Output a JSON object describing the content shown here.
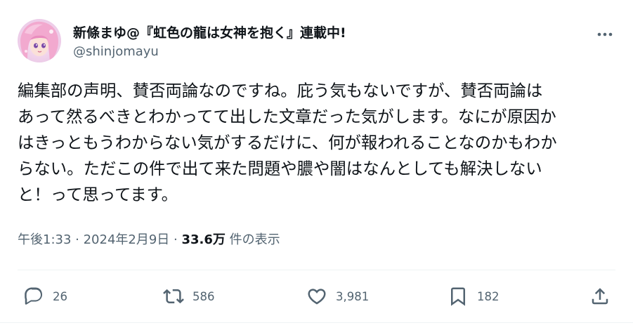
{
  "author": {
    "display_name": "新條まゆ@『虹色の龍は女神を抱く』連載中!",
    "handle": "@shinjomayu",
    "avatar_icon": "avatar-illustration"
  },
  "tweet": {
    "text": "編集部の声明、賛否両論なのですね。庇う気もないですが、賛否両論は\nあって然るべきとわかってて出した文章だった気がします。なにが原因か\nはきっともうわからない気がするだけに、何が報われることなのかもわか\nらない。ただこの件で出て来た問題や膿や闇はなんとしても解決しない\nと！って思ってます。"
  },
  "meta": {
    "time": "午後1:33",
    "separator1": " · ",
    "date": "2024年2月9日",
    "separator2": " · ",
    "views_count": "33.6万",
    "views_label": " 件の表示"
  },
  "actions": {
    "replies": "26",
    "reposts": "586",
    "likes": "3,981",
    "bookmarks": "182"
  },
  "colors": {
    "text_primary": "#0f1419",
    "text_secondary": "#536471",
    "divider": "#eff3f4"
  }
}
